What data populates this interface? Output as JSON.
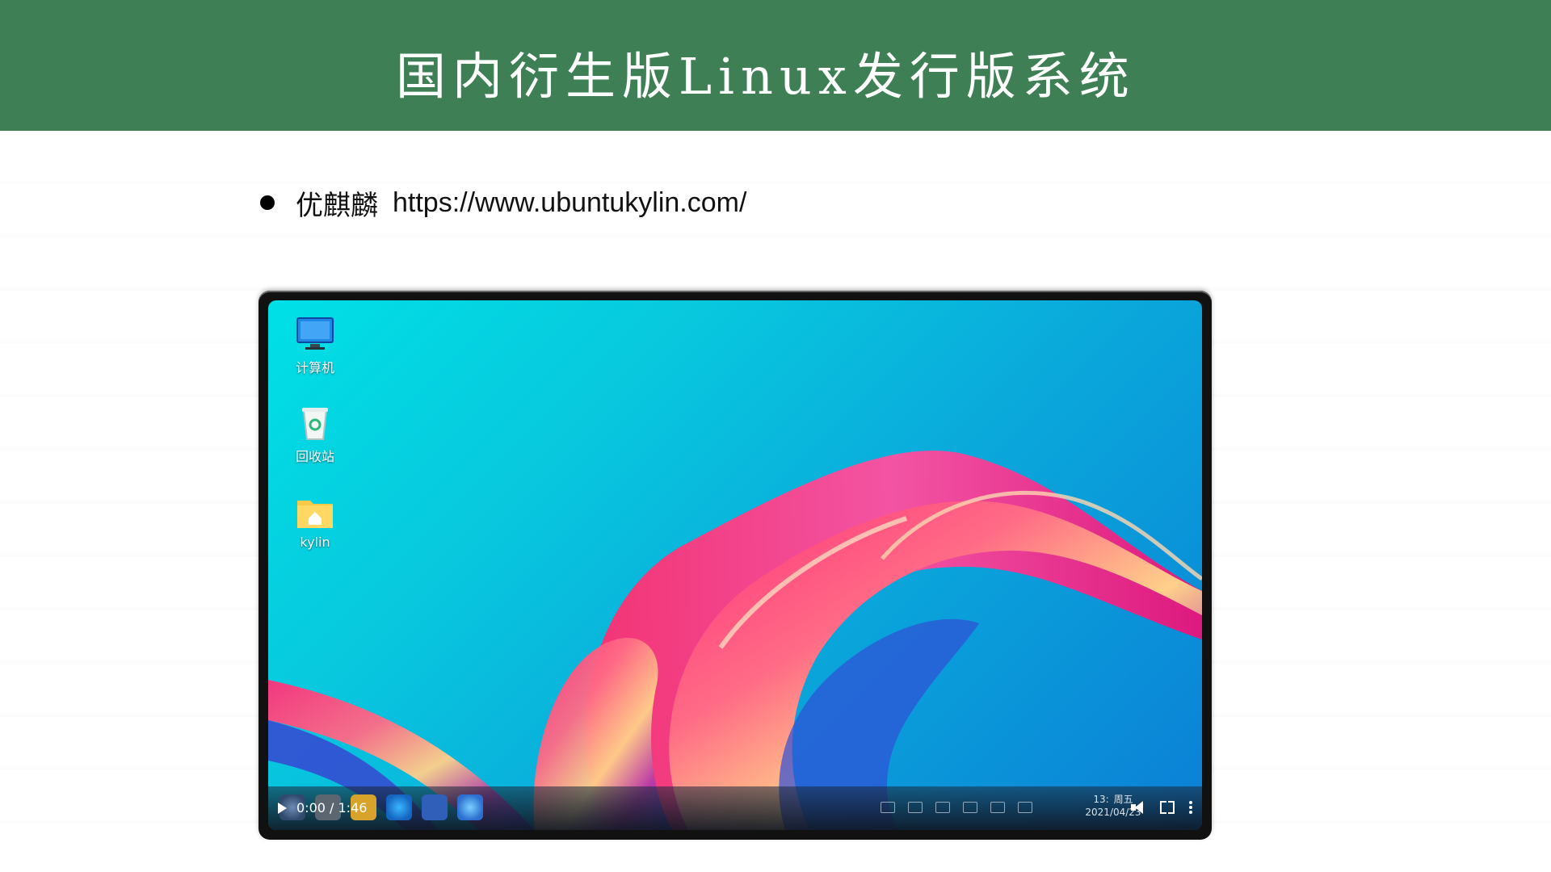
{
  "slide": {
    "title": "国内衍生版Linux发行版系统",
    "bullet": {
      "name": "优麒麟",
      "url": "https://www.ubuntukylin.com/"
    }
  },
  "desktop": {
    "icons": [
      {
        "label": "计算机",
        "icon": "computer-icon"
      },
      {
        "label": "回收站",
        "icon": "trash-icon"
      },
      {
        "label": "kylin",
        "icon": "home-folder-icon"
      }
    ],
    "clock": {
      "time": "13:",
      "weekday": "周五",
      "date": "2021/04/23"
    }
  },
  "player": {
    "time": "0:00 / 1:46",
    "controls": [
      "play-icon",
      "volume-icon",
      "fullscreen-icon",
      "more-icon"
    ]
  },
  "colors": {
    "header": "#3f7f55",
    "desktop_blue": "#0aa7db",
    "desktop_cyan": "#00e0e6",
    "ribbon_pink": "#ff2d7a"
  }
}
